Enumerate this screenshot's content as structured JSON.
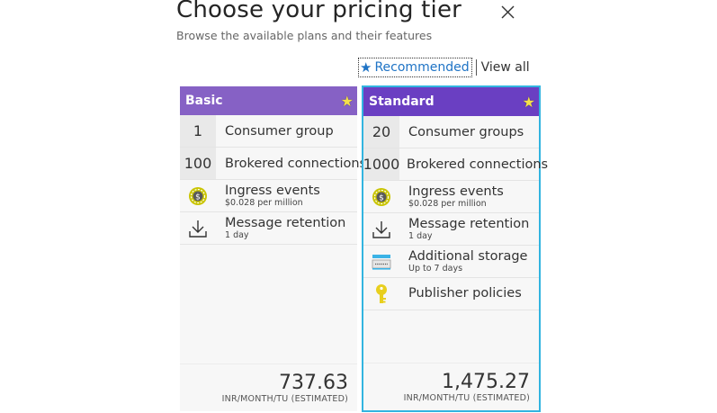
{
  "header": {
    "title": "Choose your pricing tier",
    "subtitle": "Browse the available plans and their features"
  },
  "filters": {
    "recommended_label": "Recommended",
    "view_all_label": "View all"
  },
  "tiers": [
    {
      "name": "Basic",
      "rows": [
        {
          "num": "1",
          "label": "Consumer group"
        },
        {
          "num": "100",
          "label": "Brokered connections"
        }
      ],
      "features": [
        {
          "icon": "coin-icon",
          "label": "Ingress events",
          "sub": "$0.028 per million"
        },
        {
          "icon": "download-icon",
          "label": "Message retention",
          "sub": "1 day"
        }
      ],
      "price": "737.63",
      "unit": "INR/MONTH/TU (ESTIMATED)"
    },
    {
      "name": "Standard",
      "rows": [
        {
          "num": "20",
          "label": "Consumer groups"
        },
        {
          "num": "1000",
          "label": "Brokered connections"
        }
      ],
      "features": [
        {
          "icon": "coin-icon",
          "label": "Ingress events",
          "sub": "$0.028 per million"
        },
        {
          "icon": "download-icon",
          "label": "Message retention",
          "sub": "1 day"
        },
        {
          "icon": "storage-icon",
          "label": "Additional storage",
          "sub": "Up to 7 days"
        },
        {
          "icon": "key-icon",
          "label": "Publisher policies",
          "sub": ""
        }
      ],
      "price": "1,475.27",
      "unit": "INR/MONTH/TU (ESTIMATED)"
    }
  ],
  "colors": {
    "header_basic": "#8661c5",
    "header_standard": "#6a3fc2",
    "selected_border": "#32b4e0",
    "link": "#1e73c5"
  }
}
